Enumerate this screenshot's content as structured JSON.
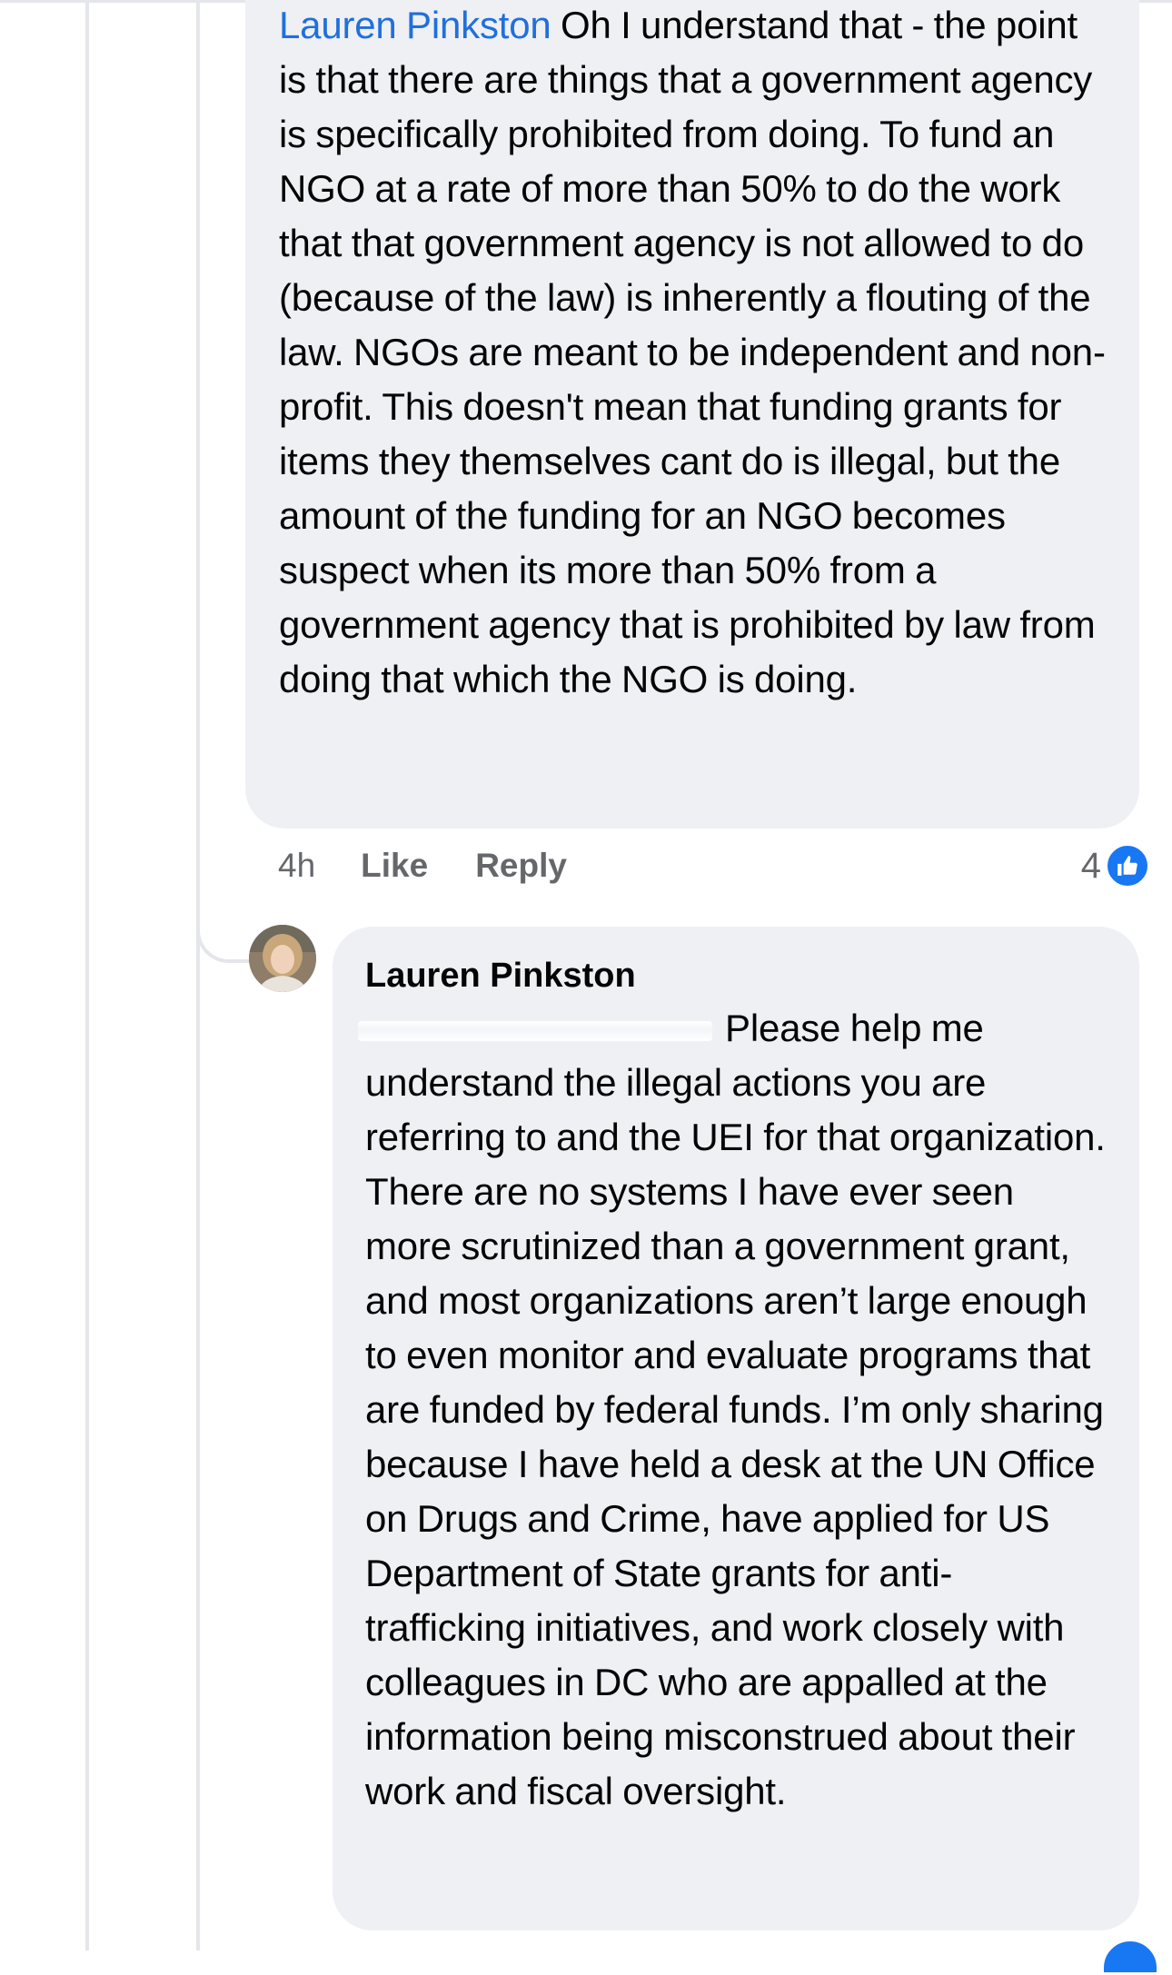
{
  "comment_1": {
    "mention": "Lauren Pinkston",
    "text": " Oh I understand that - the point is that there are things that a government agency is specifically prohibited from doing. To fund an NGO at a rate of more than 50% to do the work that that government agency is not allowed to do (because of the law) is inherently a flouting of the law. NGOs are meant to be independent and non-profit. This doesn't mean that funding grants for items they themselves cant do is illegal, but the amount of the funding for an NGO becomes suspect when its more than 50% from a government agency that is prohibited by law from doing that which the NGO is doing.",
    "timestamp": "4h",
    "like_label": "Like",
    "reply_label": "Reply",
    "reaction_count": "4",
    "reaction_icon": "thumbs-up-icon"
  },
  "comment_2": {
    "author": "Lauren Pinkston",
    "text": "Please help me understand the illegal actions you are referring to and the UEI for that organization. There are no systems I have ever seen more scrutinized than a government grant, and most organizations aren’t large enough to even monitor and evaluate programs that are funded by federal funds. I’m only sharing because I have held a desk at the UN Office on Drugs and Crime, have applied for US Department of State grants for anti-trafficking initiatives, and work closely with colleagues in DC who are appalled at the information being misconstrued about their work and fiscal oversight."
  },
  "colors": {
    "bubble": "#eef0f4",
    "mention": "#216fdb",
    "meta_text": "#65676b",
    "like_blue": "#1877f2",
    "thread_line": "#e4e6eb"
  }
}
